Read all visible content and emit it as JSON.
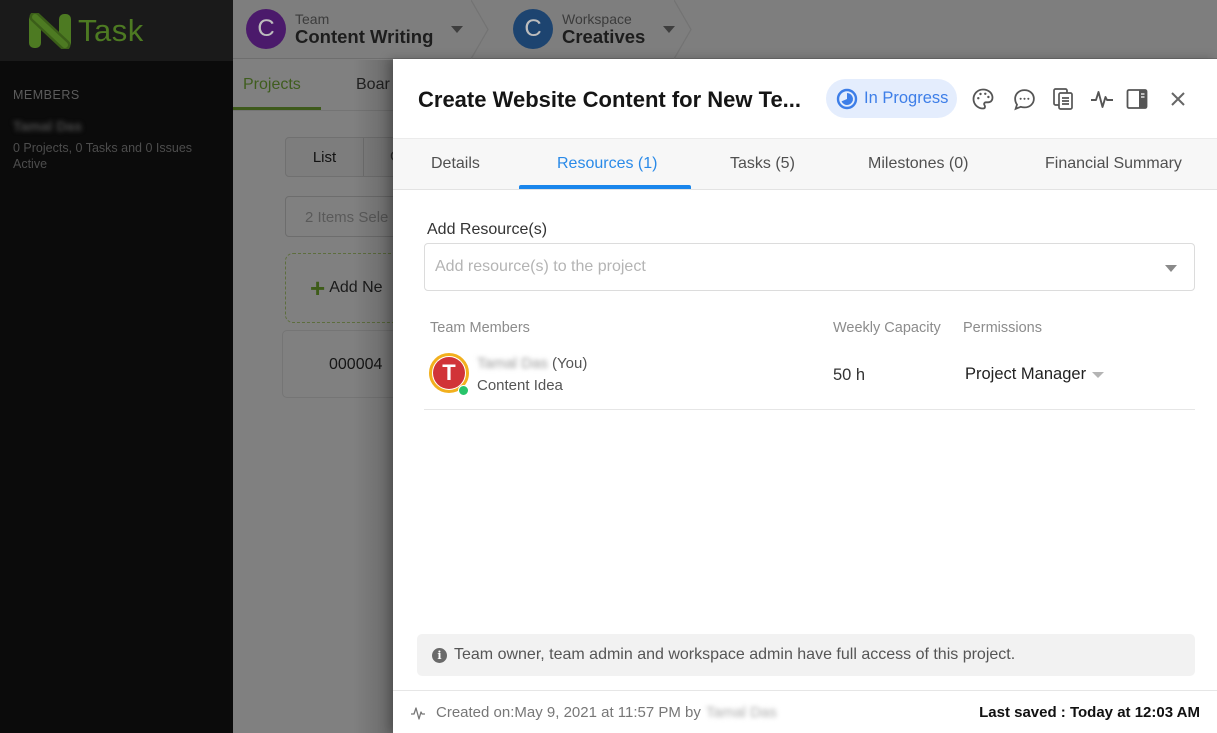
{
  "app": {
    "logo_text": "Task",
    "brand_color": "#4d7a22"
  },
  "sidebar": {
    "section_label": "MEMBERS",
    "member": {
      "name": "Tamal Das",
      "stats": "0 Projects, 0 Tasks and 0 Issues",
      "status": "Active"
    }
  },
  "topbar": {
    "team": {
      "avatar_letter": "C",
      "label": "Team",
      "name": "Content Writing",
      "color": "#4b1a6b"
    },
    "workspace": {
      "avatar_letter": "C",
      "label": "Workspace",
      "name": "Creatives",
      "color": "#1d4470"
    }
  },
  "background": {
    "tabs": [
      "Projects",
      "Boar"
    ],
    "view_toggle": [
      "List",
      "G"
    ],
    "selection_text": "2 Items Sele",
    "add_new_label": "Add Ne",
    "card_id": "000004"
  },
  "modal": {
    "title": "Create Website Content for New Te...",
    "status": {
      "label": "In Progress",
      "color": "#3d7ee8"
    },
    "header_icons": [
      "palette-icon",
      "comment-icon",
      "copy-document-icon",
      "activity-icon",
      "side-panel-icon",
      "close-icon"
    ],
    "tabs": [
      {
        "label": "Details",
        "active": false
      },
      {
        "label": "Resources (1)",
        "active": true
      },
      {
        "label": "Tasks (5)",
        "active": false
      },
      {
        "label": "Milestones (0)",
        "active": false
      },
      {
        "label": "Financial Summary",
        "active": false
      }
    ],
    "resources": {
      "field_label": "Add Resource(s)",
      "placeholder": "Add resource(s) to the project",
      "value": "",
      "columns": [
        "Team Members",
        "Weekly Capacity",
        "Permissions"
      ],
      "members": [
        {
          "avatar_letter": "T",
          "name": "Tamal Das",
          "you_tag": "(You)",
          "role": "Content Idea",
          "weekly_capacity": "50 h",
          "permission": "Project Manager",
          "online": true
        }
      ]
    },
    "info_text": "Team owner, team admin and workspace admin have full access of this project.",
    "footer": {
      "created_text": "Created on:May 9, 2021 at 11:57 PM by",
      "created_by": "Tamal Das",
      "last_saved": "Last saved : Today at 12:03 AM"
    }
  }
}
